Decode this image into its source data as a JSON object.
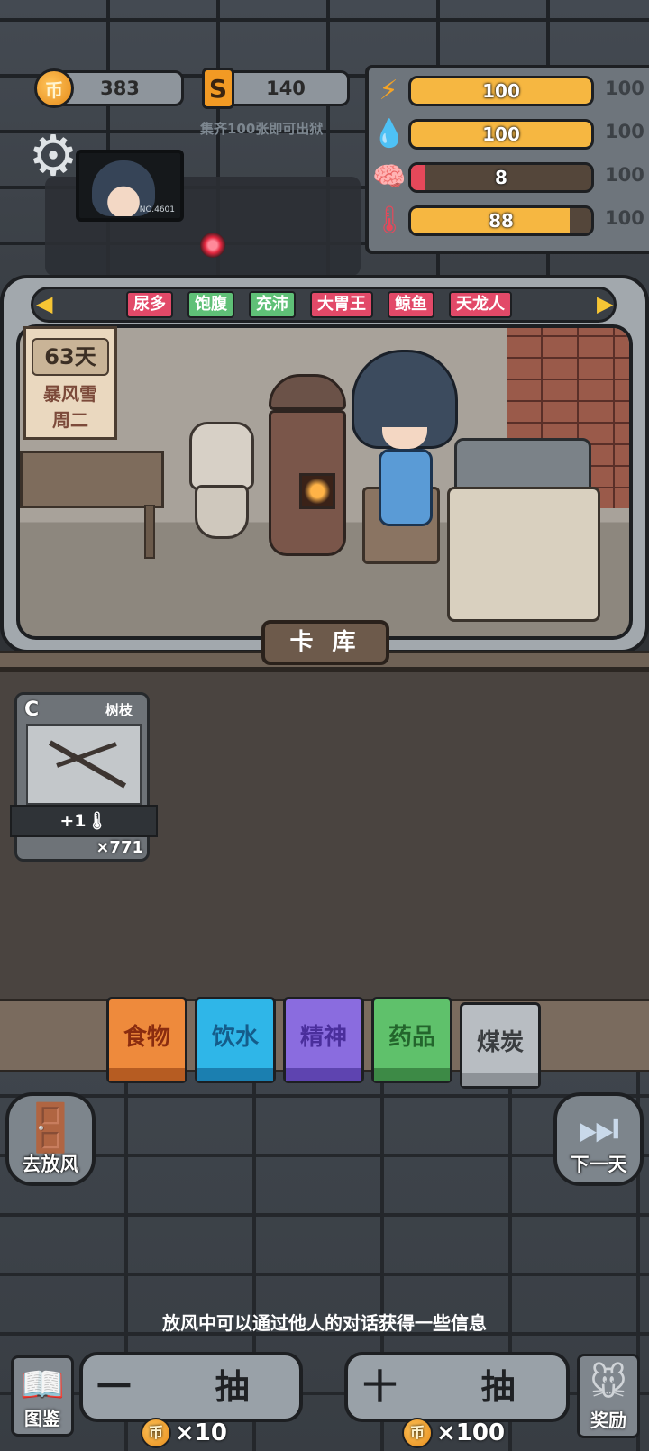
{
  "resources": {
    "coins": "383",
    "cards": "140",
    "coin_symbol": "币",
    "card_symbol": "S",
    "hint": "集齐100张即可出狱"
  },
  "portrait": {
    "badge": "NO.4601"
  },
  "stats": [
    {
      "icon": "energy-icon",
      "glyph": "⚡",
      "color": "#f6a323",
      "value": "100",
      "max": "100",
      "fill": 1.0
    },
    {
      "icon": "water-icon",
      "glyph": "💧",
      "color": "#3a9ad9",
      "value": "100",
      "max": "100",
      "fill": 1.0
    },
    {
      "icon": "brain-icon",
      "glyph": "🧠",
      "color": "#7a70e8",
      "value": "8",
      "max": "100",
      "fill": 0.08
    },
    {
      "icon": "thermometer-icon",
      "glyph": "🌡",
      "color": "#e5485a",
      "value": "88",
      "max": "100",
      "fill": 0.88
    }
  ],
  "tags": [
    "尿多",
    "饱腹",
    "充沛",
    "大胃王",
    "鲸鱼",
    "天龙人"
  ],
  "calendar": {
    "days": "63天",
    "weather": "暴风雪",
    "weekday": "周二"
  },
  "card_library_label": "卡 库",
  "cards_owned": [
    {
      "grade": "C",
      "name": "树枝",
      "effect": "+1🌡",
      "count": "×771"
    }
  ],
  "categories": [
    "食物",
    "饮水",
    "精神",
    "药品",
    "煤炭"
  ],
  "go_out_label": "去放风",
  "next_day_label": "下一天",
  "tip": "放风中可以通过他人的对话获得一些信息",
  "book_label": "图鉴",
  "draw_one": {
    "label": "一 抽",
    "cost": "×10"
  },
  "draw_ten": {
    "label": "十 抽",
    "cost": "×100"
  },
  "reward_label": "奖励",
  "colors": {
    "tag_red": "#e24968",
    "tag_green": "#5fc077",
    "accent_gold": "#f6b741"
  }
}
